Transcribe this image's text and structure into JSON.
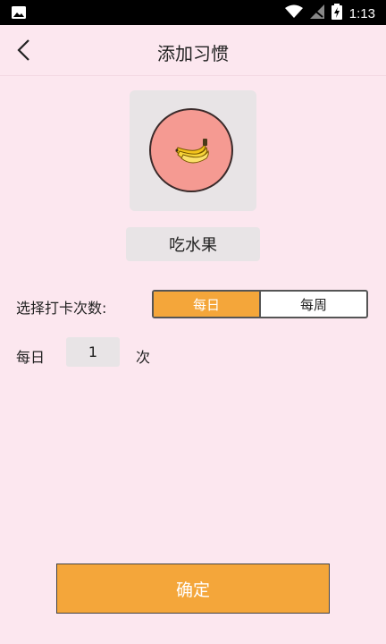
{
  "status_bar": {
    "time": "1:13",
    "icons": [
      "image-icon",
      "wifi-icon",
      "signal-icon",
      "battery-charging-icon"
    ]
  },
  "header": {
    "title": "添加习惯",
    "back_icon": "chevron-left-icon"
  },
  "habit": {
    "icon": "banana-icon",
    "icon_bg_color": "#f59a92",
    "name": "吃水果"
  },
  "frequency": {
    "label": "选择打卡次数:",
    "options": [
      "每日",
      "每周"
    ],
    "selected": "每日",
    "accent": "#f4a63a"
  },
  "count": {
    "prefix": "每日",
    "value": "1",
    "suffix": "次"
  },
  "confirm_button": {
    "label": "确定"
  }
}
